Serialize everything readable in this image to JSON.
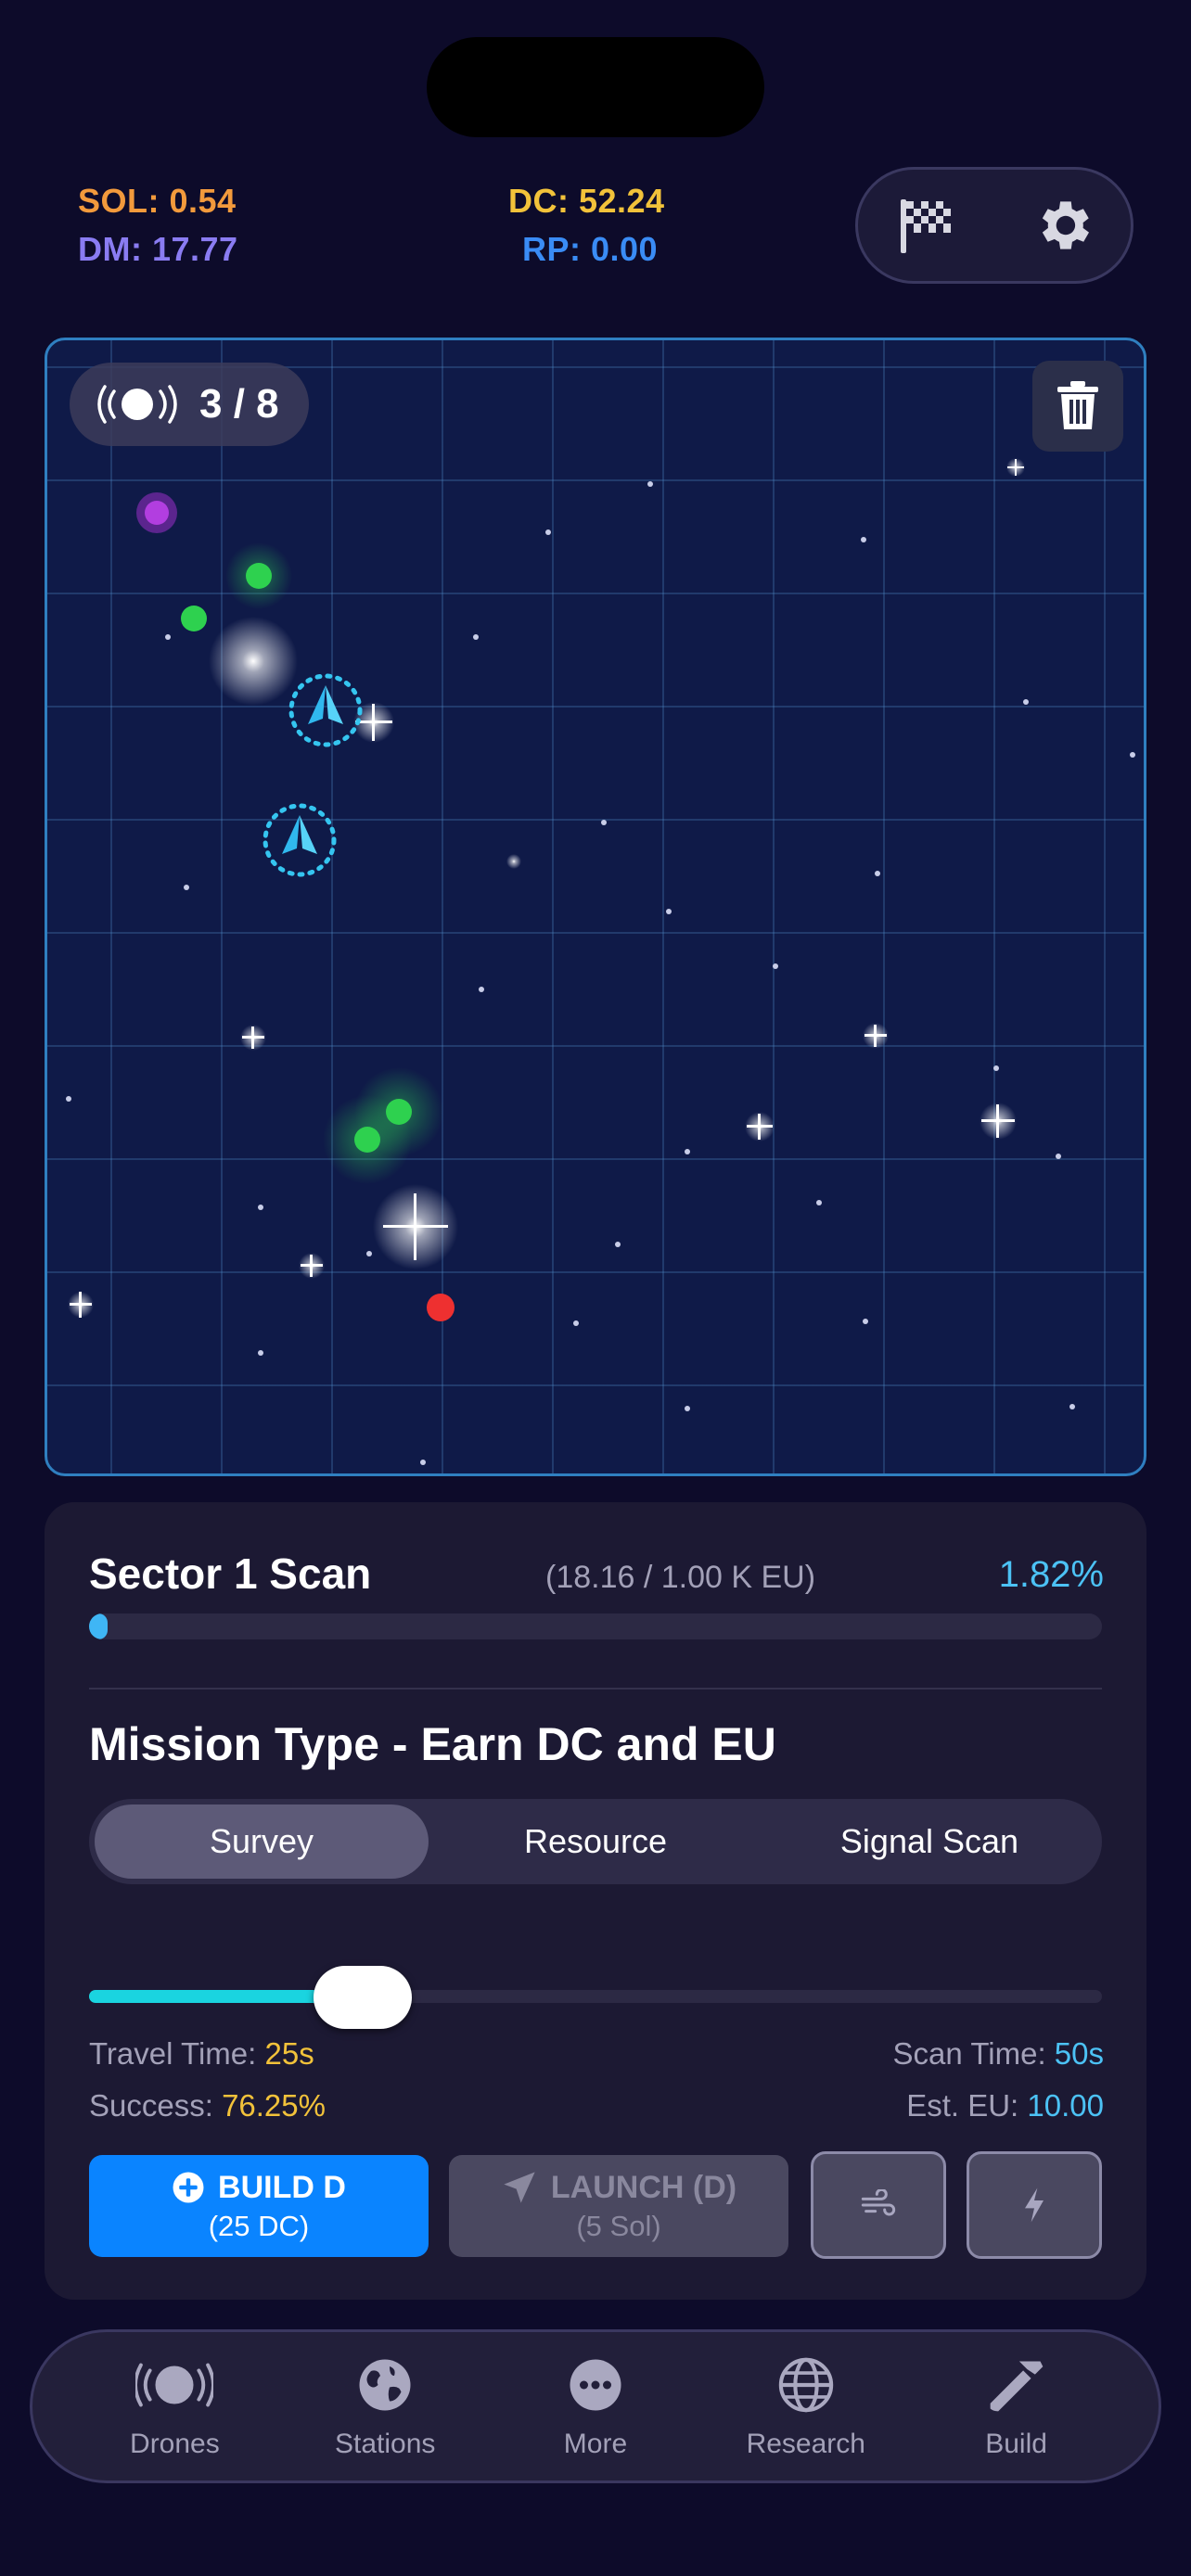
{
  "status": {
    "sol": "SOL: 0.54",
    "dm": "DM: 17.77",
    "dc": "DC: 52.24",
    "rp": "RP: 0.00"
  },
  "map": {
    "drone_count": "3 / 8",
    "grid": true
  },
  "scan": {
    "title": "Sector 1 Scan",
    "eu": "(18.16 / 1.00 K EU)",
    "percent_label": "1.82%",
    "progress": 0.0182
  },
  "mission": {
    "title": "Mission Type - Earn DC and EU",
    "tabs": [
      "Survey",
      "Resource",
      "Signal Scan"
    ],
    "selected_tab": "Survey",
    "slider_level": 0.24,
    "travel_label": "Travel Time: ",
    "travel_value": "25s",
    "success_label": "Success: ",
    "success_value": "76.25%",
    "scan_label": "Scan Time: ",
    "scan_value": "50s",
    "eu_label": "Est. EU: ",
    "eu_value": "10.00"
  },
  "actions": {
    "build_label": "BUILD D",
    "build_cost": "(25 DC)",
    "launch_label": "LAUNCH (D)",
    "launch_cost": "(5 Sol)"
  },
  "tabbar": {
    "items": [
      {
        "label": "Drones",
        "icon": "drone-icon"
      },
      {
        "label": "Stations",
        "icon": "globe-icon"
      },
      {
        "label": "More",
        "icon": "more-icon"
      },
      {
        "label": "Research",
        "icon": "network-globe-icon"
      },
      {
        "label": "Build",
        "icon": "hammer-icon"
      }
    ]
  },
  "colors": {
    "background": "#0d0b2a",
    "accent_blue": "#0a84ff",
    "cyan": "#4cc2f5",
    "yellow": "#f2c23a",
    "orange": "#f29a3c",
    "purple": "#8a7cf2"
  }
}
